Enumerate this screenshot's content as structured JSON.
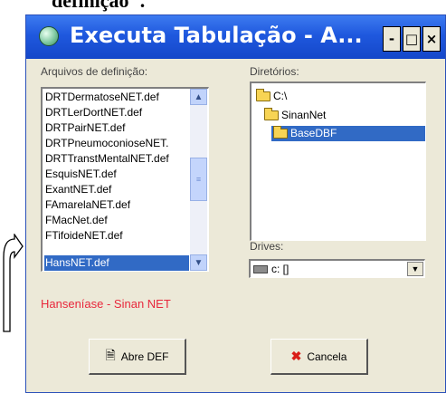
{
  "document_fragment": "definição\".",
  "window": {
    "title": "Executa Tabulação - A...",
    "buttons": {
      "minimize": "-",
      "maximize": "□",
      "close": "×"
    }
  },
  "files": {
    "label": "Arquivos de definição:",
    "items": [
      "DRTDermatoseNET.def",
      "DRTLerDortNET.def",
      "DRTPairNET.def",
      "DRTPneumoconioseNET.",
      "DRTTranstMentalNET.def",
      "EsquisNET.def",
      "ExantNET.def",
      "FAmarelaNET.def",
      "FMacNet.def",
      "FTifoideNET.def",
      "HansNET.def"
    ],
    "selected": "HansNET.def"
  },
  "directories": {
    "label": "Diretórios:",
    "items": [
      "C:\\",
      "SinanNet",
      "BaseDBF"
    ],
    "selected": "BaseDBF"
  },
  "drives": {
    "label": "Drives:",
    "value": "c: []"
  },
  "description": "Hanseníase - Sinan NET",
  "actions": {
    "open_label": "Abre DEF",
    "cancel_label": "Cancela"
  },
  "colors": {
    "title_bar": "#1f58de",
    "selection": "#316ac5",
    "description_text": "#e8283c",
    "cancel_icon": "#d91e18"
  },
  "icons": [
    "app-icon",
    "folder-icon",
    "drive-icon",
    "open-file-icon",
    "cancel-x-icon"
  ]
}
